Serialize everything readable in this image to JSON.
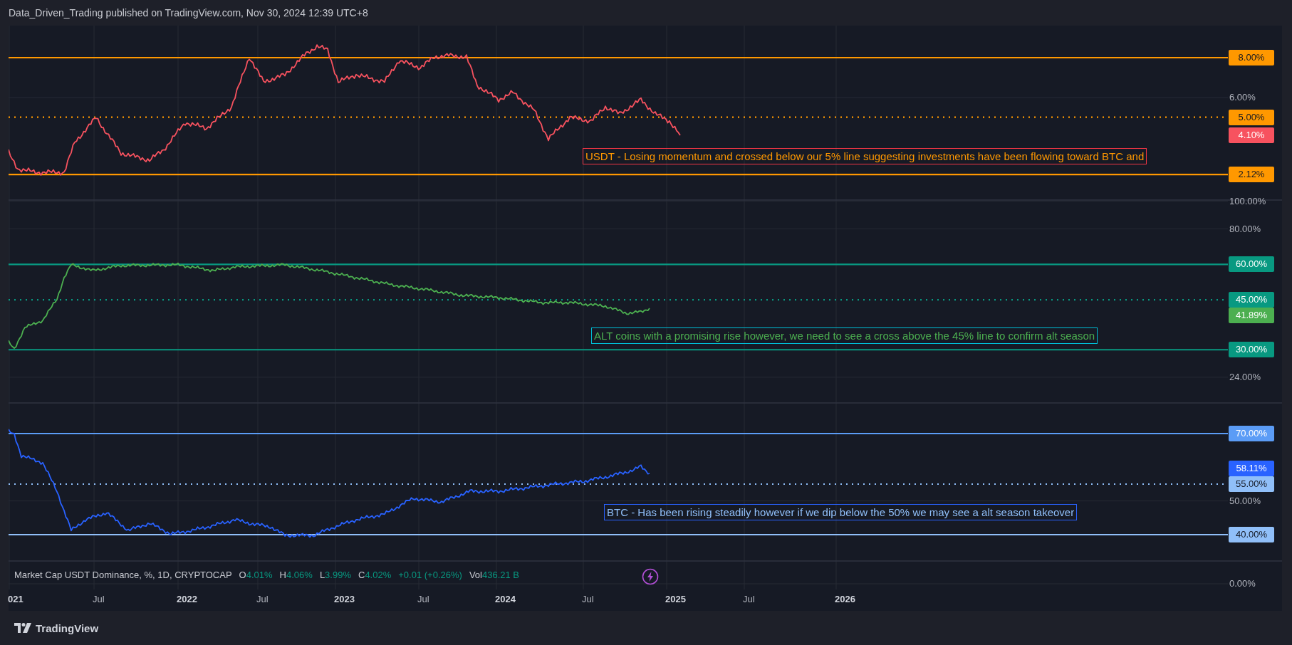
{
  "header": {
    "text": "Data_Driven_Trading published on TradingView.com, Nov 30, 2024 12:39 UTC+8"
  },
  "panes": [
    {
      "ticks": [
        "6.00%"
      ],
      "levels": [
        {
          "label": "8.00%",
          "kind": "solid",
          "color": "#ff9800"
        },
        {
          "label": "5.00%",
          "kind": "dotted",
          "color": "#ff9800"
        },
        {
          "label": "2.12%",
          "kind": "solid",
          "color": "#ff9800"
        }
      ],
      "current": {
        "label": "4.10%",
        "color": "#f7525f"
      },
      "note": {
        "text": "USDT - Losing momentum and crossed below our 5% line suggesting investments have been flowing toward BTC and",
        "color": "#ff9800"
      }
    },
    {
      "ticks": [
        "100.00%",
        "80.00%",
        "24.00%"
      ],
      "levels": [
        {
          "label": "60.00%",
          "kind": "solid",
          "color": "#089981"
        },
        {
          "label": "45.00%",
          "kind": "dotted",
          "color": "#089981"
        },
        {
          "label": "30.00%",
          "kind": "solid",
          "color": "#089981"
        }
      ],
      "current": {
        "label": "41.89%",
        "color": "#4caf50"
      },
      "note": {
        "text": "ALT coins with a promising rise however, we need to see a cross above the 45% line to confirm alt season",
        "color": "#4caf50"
      }
    },
    {
      "ticks": [
        "50.00%"
      ],
      "levels": [
        {
          "label": "70.00%",
          "kind": "solid",
          "color": "#5b9cf6"
        },
        {
          "label": "55.00%",
          "kind": "dotted",
          "color": "#90bff9"
        },
        {
          "label": "40.00%",
          "kind": "solid",
          "color": "#90bff9"
        }
      ],
      "current": {
        "label": "58.11%",
        "color": "#2962ff"
      },
      "note": {
        "text": "BTC - Has been rising steadily however if we dip below the 50% we may see a alt season takeover",
        "color": "#90bff9"
      }
    }
  ],
  "legend": {
    "title": "Market Cap USDT Dominance, %, 1D, CRYPTOCAP",
    "ohlc": [
      {
        "key": "O",
        "value": "4.01%"
      },
      {
        "key": "H",
        "value": "4.06%"
      },
      {
        "key": "L",
        "value": "3.99%"
      },
      {
        "key": "C",
        "value": "4.02%"
      }
    ],
    "change": "+0.01 (+0.26%)",
    "volume": {
      "key": "Vol",
      "value": "436.21 B"
    },
    "tick": "0.00%"
  },
  "x_axis": [
    {
      "label": "021",
      "major": true
    },
    {
      "label": "Jul",
      "major": false
    },
    {
      "label": "2022",
      "major": true
    },
    {
      "label": "Jul",
      "major": false
    },
    {
      "label": "2023",
      "major": true
    },
    {
      "label": "Jul",
      "major": false
    },
    {
      "label": "2024",
      "major": true
    },
    {
      "label": "Jul",
      "major": false
    },
    {
      "label": "2025",
      "major": true
    },
    {
      "label": "Jul",
      "major": false
    },
    {
      "label": "2026",
      "major": true
    }
  ],
  "footer": {
    "brand": "TradingView"
  }
}
